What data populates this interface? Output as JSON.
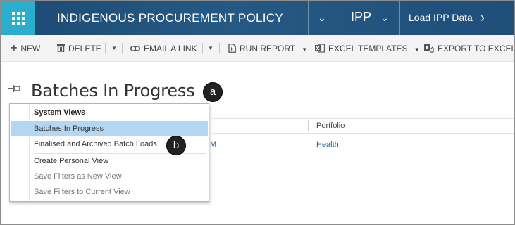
{
  "nav": {
    "app_title": "INDIGENOUS PROCUREMENT POLICY",
    "area_label": "IPP",
    "entity_label": "Load IPP Data",
    "waffle_icon": "waffle-grid-icon",
    "colors": {
      "bar": "#1f4e79",
      "waffle": "#2aaecb"
    }
  },
  "commands": {
    "new": "NEW",
    "delete": "DELETE",
    "email_link": "EMAIL A LINK",
    "run_report": "RUN REPORT",
    "excel_templates": "EXCEL TEMPLATES",
    "export_excel": "EXPORT TO EXCEL"
  },
  "view": {
    "title": "Batches In Progress",
    "callout_a": "a",
    "callout_b": "b"
  },
  "dropdown": {
    "heading": "System Views",
    "items": [
      {
        "label": "Batches In Progress",
        "selected": true
      },
      {
        "label": "Finalised and Archived Batch Loads",
        "selected": false
      }
    ],
    "actions": [
      {
        "label": "Create Personal View"
      },
      {
        "label": "Save Filters as New View"
      },
      {
        "label": "Save Filters to Current View"
      }
    ],
    "selected_color": "#b3d7f3"
  },
  "grid": {
    "column_portfolio": "Portfolio",
    "row_partial": "M",
    "row_portfolio": "Health"
  }
}
